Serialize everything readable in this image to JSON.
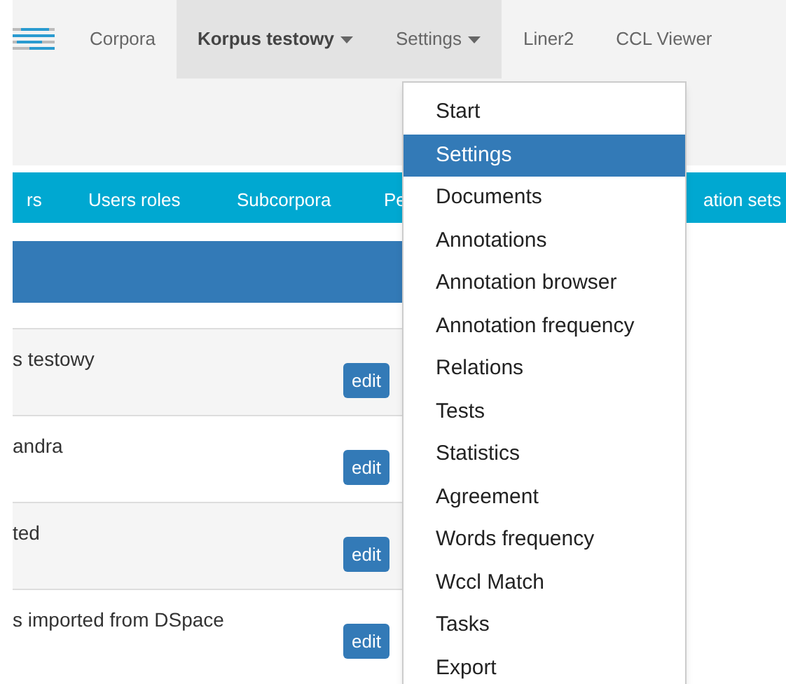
{
  "navbar": {
    "items": [
      {
        "label": "Corpora",
        "active": false,
        "dropdown": false,
        "bold": false
      },
      {
        "label": "Korpus testowy",
        "active": true,
        "dropdown": true,
        "bold": true
      },
      {
        "label": "Settings",
        "active": true,
        "dropdown": true,
        "bold": false
      },
      {
        "label": "Liner2",
        "active": false,
        "dropdown": false,
        "bold": false
      },
      {
        "label": "CCL Viewer",
        "active": false,
        "dropdown": false,
        "bold": false
      }
    ]
  },
  "tabs": [
    "rs",
    "Users roles",
    "Subcorpora",
    "Pe",
    "ation sets"
  ],
  "table": {
    "rows": [
      {
        "name": "s testowy",
        "button": "edit"
      },
      {
        "name": "andra",
        "button": "edit"
      },
      {
        "name": "ted",
        "button": "edit"
      },
      {
        "name": "s imported from DSpace",
        "button": "edit"
      }
    ]
  },
  "dropdown_menu": {
    "items": [
      {
        "label": "Start",
        "selected": false
      },
      {
        "label": "Settings",
        "selected": true
      },
      {
        "label": "Documents",
        "selected": false
      },
      {
        "label": "Annotations",
        "selected": false
      },
      {
        "label": "Annotation browser",
        "selected": false
      },
      {
        "label": "Annotation frequency",
        "selected": false
      },
      {
        "label": "Relations",
        "selected": false
      },
      {
        "label": "Tests",
        "selected": false
      },
      {
        "label": "Statistics",
        "selected": false
      },
      {
        "label": "Agreement",
        "selected": false
      },
      {
        "label": "Words frequency",
        "selected": false
      },
      {
        "label": "Wccl Match",
        "selected": false
      },
      {
        "label": "Tasks",
        "selected": false
      },
      {
        "label": "Export",
        "selected": false
      }
    ]
  }
}
